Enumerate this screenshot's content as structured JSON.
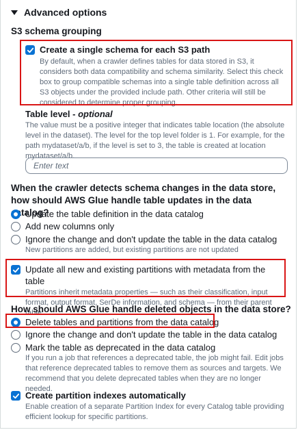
{
  "section": {
    "title": "Advanced options"
  },
  "s3_grouping": {
    "heading": "S3 schema grouping",
    "option_title": "Create a single schema for each S3 path",
    "description": "By default, when a crawler defines tables for data stored in S3, it considers both data compatibility and schema similarity. Select this check box to group compatible schemas into a single table definition across all S3 objects under the provided include path. Other criteria will still be considered to determine proper grouping.",
    "checked": true
  },
  "table_level": {
    "label": "Table level",
    "label_suffix": " - ",
    "optional": "optional",
    "description": "The value must be a positive integer that indicates table location (the absolute level in the dataset). The level for the top level folder is 1. For example, for the path mydataset/a/b, if the level is set to 3, the table is created at location mydataset/a/b.",
    "placeholder": "Enter text",
    "value": ""
  },
  "schema_changes": {
    "heading": "When the crawler detects schema changes in the data store, how should AWS Glue handle table updates in the data catalog?",
    "options": [
      {
        "label": "Update the table definition in the data catalog",
        "selected": true
      },
      {
        "label": "Add new columns only",
        "selected": false
      },
      {
        "label": "Ignore the change and don't update the table in the data catalog",
        "selected": false,
        "description": "New partitions are added, but existing partitions are not updated"
      }
    ]
  },
  "partitions_update": {
    "title": "Update all new and existing partitions with metadata from the table",
    "description": "Partitions inherit metadata properties — such as their classification, input format, output format, SerDe information, and schema — from their parent table.",
    "checked": true
  },
  "deleted_objects": {
    "heading": "How should AWS Glue handle deleted objects in the data store?",
    "options": [
      {
        "label": "Delete tables and partitions from the data catalog",
        "selected": true
      },
      {
        "label": "Ignore the change and don't update the table in the data catalog",
        "selected": false
      },
      {
        "label": "Mark the table as deprecated in the data catalog",
        "selected": false,
        "description": "If you run a job that references a deprecated table, the job might fail. Edit jobs that reference deprecated tables to remove them as sources and targets. We recommend that you delete deprecated tables when they are no longer needed."
      }
    ]
  },
  "partition_indexes": {
    "title": "Create partition indexes automatically",
    "description": "Enable creation of a separate Partition Index for every Catalog table providing efficient lookup for specific partitions.",
    "checked": true
  },
  "colors": {
    "accent": "#0972d3",
    "highlight": "#d91515",
    "muted_text": "#5f6b7a"
  }
}
